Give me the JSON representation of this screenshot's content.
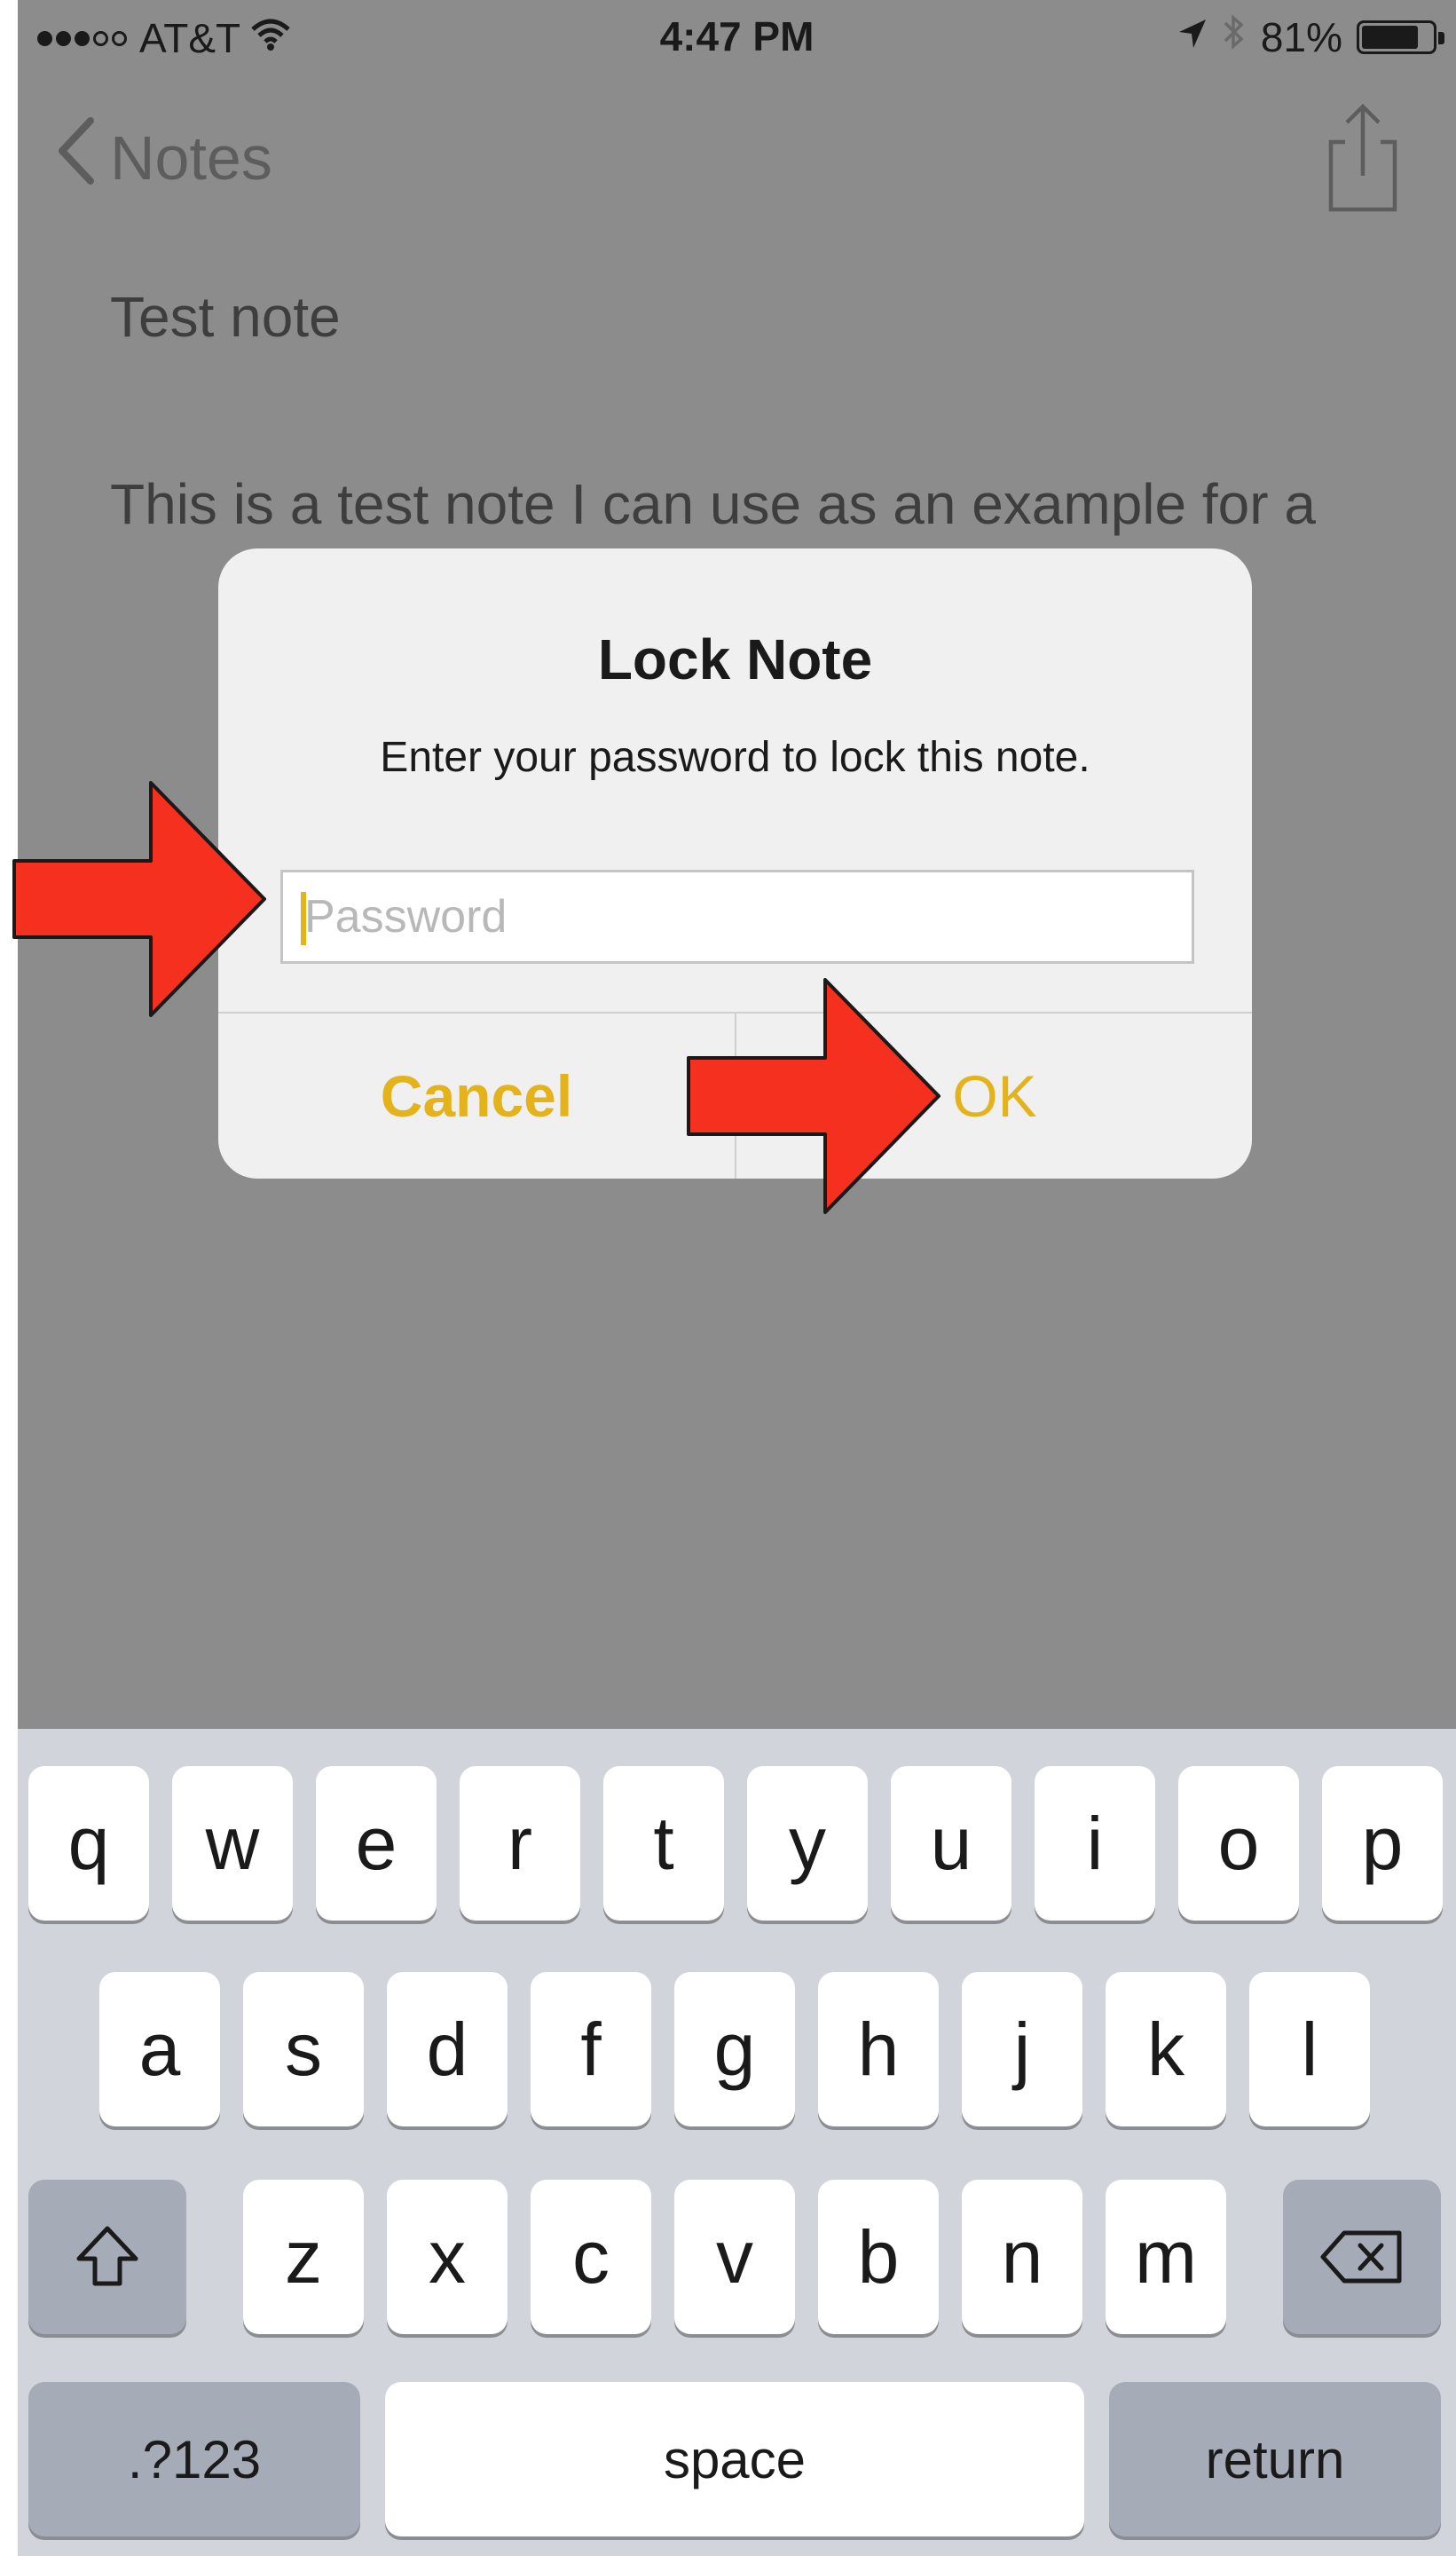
{
  "status_bar": {
    "carrier": "AT&T",
    "time": "4:47 PM",
    "battery_percent": "81%",
    "battery_level": 0.81,
    "signal_bars_filled": 3,
    "signal_bars_total": 5
  },
  "nav": {
    "back_label": "Notes"
  },
  "note": {
    "title": "Test note",
    "body": "This is a test note I can use as an example for a"
  },
  "alert": {
    "title": "Lock Note",
    "message": "Enter your password to lock this note.",
    "password_placeholder": "Password",
    "cancel_label": "Cancel",
    "ok_label": "OK"
  },
  "keyboard": {
    "row1": [
      "q",
      "w",
      "e",
      "r",
      "t",
      "y",
      "u",
      "i",
      "o",
      "p"
    ],
    "row2": [
      "a",
      "s",
      "d",
      "f",
      "g",
      "h",
      "j",
      "k",
      "l"
    ],
    "row3": [
      "z",
      "x",
      "c",
      "v",
      "b",
      "n",
      "m"
    ],
    "numbers_label": ".?123",
    "space_label": "space",
    "return_label": "return"
  },
  "colors": {
    "accent": "#e4b31c",
    "arrow": "#f5301e",
    "dim_background": "#8c8c8c",
    "keyboard_background": "#d1d5db"
  }
}
